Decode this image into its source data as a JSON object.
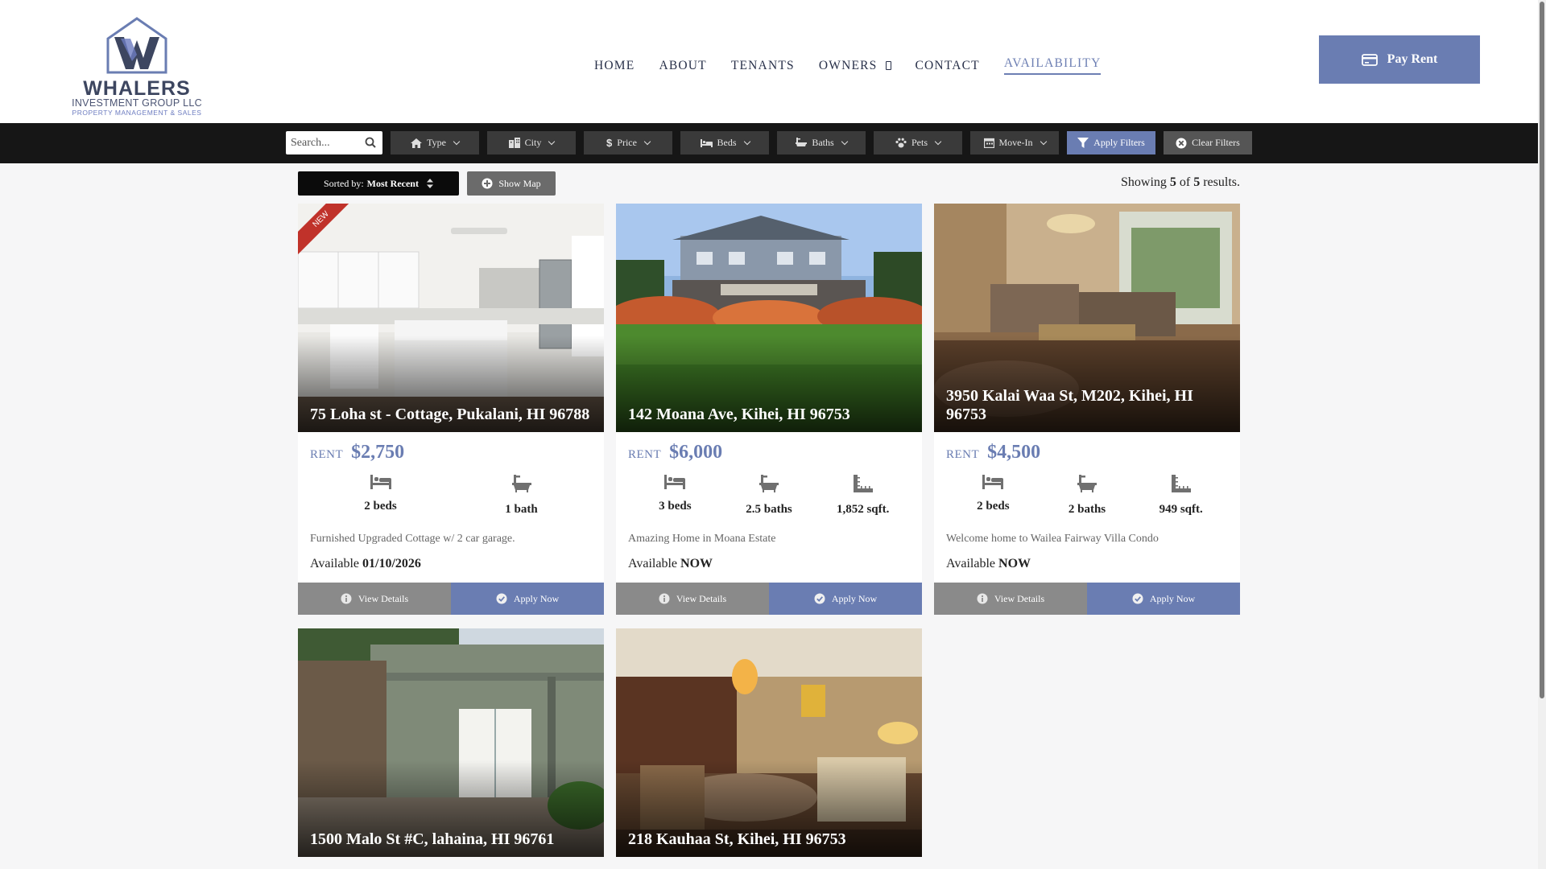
{
  "logo": {
    "line1": "WHALERS",
    "line2": "INVESTMENT GROUP LLC",
    "line3": "PROPERTY MANAGEMENT & SALES",
    "brand_color": "#3d4660",
    "accent_color": "#6d7cc0"
  },
  "nav": [
    {
      "label": "HOME"
    },
    {
      "label": "ABOUT"
    },
    {
      "label": "TENANTS"
    },
    {
      "label": "OWNERS"
    },
    {
      "label": "CONTACT"
    },
    {
      "label": "AVAILABILITY",
      "active": true
    }
  ],
  "pay_rent": {
    "label": "Pay Rent",
    "icon": "credit-card-icon"
  },
  "filters": {
    "search_placeholder": "Search...",
    "type": "Type",
    "city": "City",
    "price": "Price",
    "beds": "Beds",
    "baths": "Baths",
    "pets": "Pets",
    "move_in": "Move-In",
    "apply": "Apply Filters",
    "clear": "Clear Filters"
  },
  "sort": {
    "prefix": "Sorted by:",
    "value": "Most Recent"
  },
  "show_map": "Show Map",
  "results": {
    "prefix": "Showing",
    "shown": "5",
    "of": "of",
    "total": "5",
    "suffix": "results."
  },
  "card_labels": {
    "rent": "RENT",
    "view_details": "View Details",
    "apply_now": "Apply Now",
    "available": "Available"
  },
  "listings": [
    {
      "address": "75 Loha st - Cottage, Pukalani, HI 96788",
      "rent": "$2,750",
      "beds": "2 beds",
      "baths": "1 bath",
      "sqft": "",
      "description": "Furnished Upgraded Cottage w/ 2 car garage.",
      "available": "01/10/2026",
      "badge": "NEW"
    },
    {
      "address": "142 Moana Ave, Kihei, HI 96753",
      "rent": "$6,000",
      "beds": "3 beds",
      "baths": "2.5 baths",
      "sqft": "1,852 sqft.",
      "description": "Amazing Home in Moana Estate",
      "available": "NOW"
    },
    {
      "address": "3950 Kalai Waa St, M202, Kihei, HI 96753",
      "rent": "$4,500",
      "beds": "2 beds",
      "baths": "2 baths",
      "sqft": "949 sqft.",
      "description": "Welcome home to Wailea Fairway Villa Condo",
      "available": "NOW"
    },
    {
      "address": "1500 Malo St #C, lahaina, HI 96761"
    },
    {
      "address": "218 Kauhaa St, Kihei, HI 96753"
    }
  ],
  "colors": {
    "primary": "#6a7db2",
    "filterbar": "#161616",
    "badge": "#c0322a"
  }
}
